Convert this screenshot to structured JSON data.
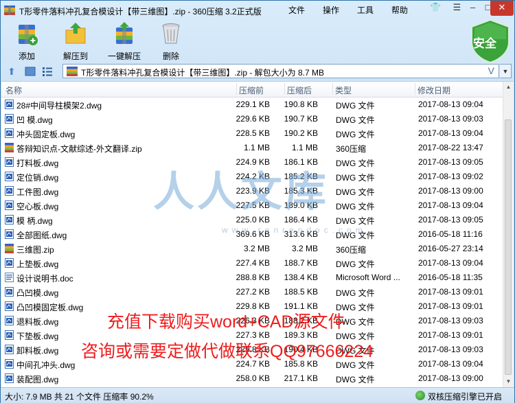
{
  "window": {
    "title": "T形零件落料冲孔复合模设计【带三维图】.zip - 360压缩 3.2正式版",
    "menu": [
      "文件",
      "操作",
      "工具",
      "帮助"
    ]
  },
  "toolbar": {
    "buttons": [
      {
        "label": "添加",
        "icon": "add-archive-icon"
      },
      {
        "label": "解压到",
        "icon": "extract-to-icon"
      },
      {
        "label": "一键解压",
        "icon": "one-click-extract-icon"
      },
      {
        "label": "删除",
        "icon": "trash-icon"
      }
    ],
    "security_label": "安全"
  },
  "address": {
    "path": "T形零件落料冲孔复合模设计【带三维图】.zip - 解包大小为 8.7 MB",
    "v_label": "V"
  },
  "columns": [
    "名称",
    "压缩前",
    "压缩后",
    "类型",
    "修改日期"
  ],
  "files": [
    {
      "name": "28#中间导柱模架2.dwg",
      "csize": "229.1 KB",
      "osize": "190.8 KB",
      "type": "DWG 文件",
      "date": "2017-08-13 09:04",
      "icon": "dwg"
    },
    {
      "name": "凹  模.dwg",
      "csize": "229.6 KB",
      "osize": "190.7 KB",
      "type": "DWG 文件",
      "date": "2017-08-13 09:03",
      "icon": "dwg"
    },
    {
      "name": "冲头固定板.dwg",
      "csize": "228.5 KB",
      "osize": "190.2 KB",
      "type": "DWG 文件",
      "date": "2017-08-13 09:04",
      "icon": "dwg"
    },
    {
      "name": "答辩知识点-文献综述-外文翻译.zip",
      "csize": "1.1 MB",
      "osize": "1.1 MB",
      "type": "360压缩",
      "date": "2017-08-22 13:47",
      "icon": "zip"
    },
    {
      "name": "打料板.dwg",
      "csize": "224.9 KB",
      "osize": "186.1 KB",
      "type": "DWG 文件",
      "date": "2017-08-13 09:05",
      "icon": "dwg"
    },
    {
      "name": "定位销.dwg",
      "csize": "224.2 KB",
      "osize": "185.2 KB",
      "type": "DWG 文件",
      "date": "2017-08-13 09:02",
      "icon": "dwg"
    },
    {
      "name": "工件图.dwg",
      "csize": "223.9 KB",
      "osize": "185.3 KB",
      "type": "DWG 文件",
      "date": "2017-08-13 09:00",
      "icon": "dwg"
    },
    {
      "name": "空心板.dwg",
      "csize": "227.5 KB",
      "osize": "189.0 KB",
      "type": "DWG 文件",
      "date": "2017-08-13 09:04",
      "icon": "dwg"
    },
    {
      "name": "模  柄.dwg",
      "csize": "225.0 KB",
      "osize": "186.4 KB",
      "type": "DWG 文件",
      "date": "2017-08-13 09:05",
      "icon": "dwg"
    },
    {
      "name": "全部图纸.dwg",
      "csize": "369.6 KB",
      "osize": "313.6 KB",
      "type": "DWG 文件",
      "date": "2016-05-18 11:16",
      "icon": "dwg"
    },
    {
      "name": "三维图.zip",
      "csize": "3.2 MB",
      "osize": "3.2 MB",
      "type": "360压缩",
      "date": "2016-05-27 23:14",
      "icon": "zip"
    },
    {
      "name": "上垫板.dwg",
      "csize": "227.4 KB",
      "osize": "188.7 KB",
      "type": "DWG 文件",
      "date": "2017-08-13 09:04",
      "icon": "dwg"
    },
    {
      "name": "设计说明书.doc",
      "csize": "288.8 KB",
      "osize": "138.4 KB",
      "type": "Microsoft Word ...",
      "date": "2016-05-18 11:35",
      "icon": "doc"
    },
    {
      "name": "凸凹模.dwg",
      "csize": "227.2 KB",
      "osize": "188.5 KB",
      "type": "DWG 文件",
      "date": "2017-08-13 09:01",
      "icon": "dwg"
    },
    {
      "name": "凸凹模固定板.dwg",
      "csize": "229.8 KB",
      "osize": "191.1 KB",
      "type": "DWG 文件",
      "date": "2017-08-13 09:01",
      "icon": "dwg"
    },
    {
      "name": "退料板.dwg",
      "csize": "226.3 KB",
      "osize": "188.2 KB",
      "type": "DWG 文件",
      "date": "2017-08-13 09:03",
      "icon": "dwg"
    },
    {
      "name": "下垫板.dwg",
      "csize": "227.3 KB",
      "osize": "189.3 KB",
      "type": "DWG 文件",
      "date": "2017-08-13 09:01",
      "icon": "dwg"
    },
    {
      "name": "卸料板.dwg",
      "csize": "229.8 KB",
      "osize": "190.4 KB",
      "type": "DWG 文件",
      "date": "2017-08-13 09:03",
      "icon": "dwg"
    },
    {
      "name": "中间孔冲头.dwg",
      "csize": "224.7 KB",
      "osize": "185.8 KB",
      "type": "DWG 文件",
      "date": "2017-08-13 09:04",
      "icon": "dwg"
    },
    {
      "name": "装配图.dwg",
      "csize": "258.0 KB",
      "osize": "217.1 KB",
      "type": "DWG 文件",
      "date": "2017-08-13 09:00",
      "icon": "dwg"
    }
  ],
  "watermark": {
    "logo": "人人文库",
    "url": "www.renrendoc.com"
  },
  "promo": {
    "line1": "充值下载购买word+CAD源文件",
    "line2": "咨询或需要定做代做联系QQ97666224"
  },
  "status": {
    "summary": "大小: 7.9 MB 共 21 个文件 压缩率 90.2%",
    "right": "双核压缩引擎已开启"
  },
  "colors": {
    "accent": "#2f72a8",
    "promo": "#ef1c1c",
    "shield": "#3aa33a"
  }
}
